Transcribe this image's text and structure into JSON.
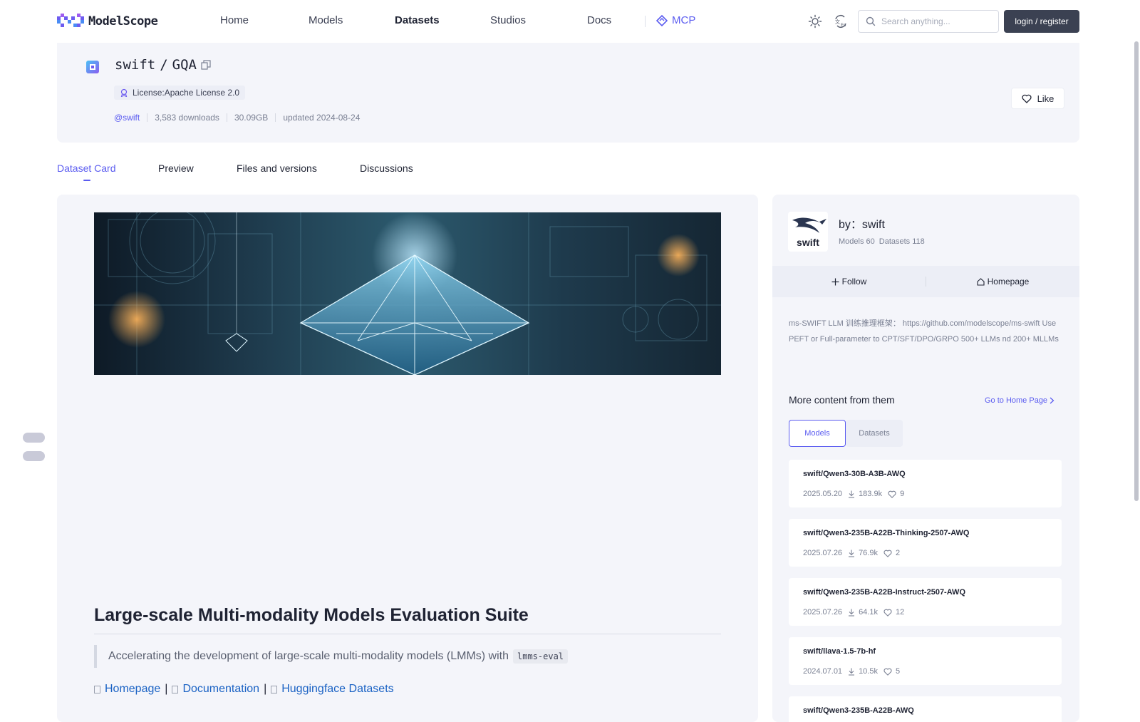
{
  "brand": {
    "logo_text": "ModelScope",
    "accent": "#5b5cf0"
  },
  "nav": {
    "items": [
      "Home",
      "Models",
      "Datasets",
      "Studios",
      "Docs"
    ],
    "mcp_label": "MCP"
  },
  "search": {
    "placeholder": "Search anything..."
  },
  "login_label": "login / register",
  "dataset": {
    "owner": "swift",
    "separator": "/",
    "name": "GQA",
    "license": "License:Apache License 2.0",
    "owner_handle": "@swift",
    "downloads": "3,583 downloads",
    "size": "30.09GB",
    "updated": "updated 2024-08-24",
    "like_label": "Like"
  },
  "tabs": [
    "Dataset Card",
    "Preview",
    "Files and versions",
    "Discussions"
  ],
  "card": {
    "title": "Large-scale Multi-modality Models Evaluation Suite",
    "quote_text": "Accelerating the development of large-scale multi-modality models (LMMs) with",
    "quote_code": "lmms-eval",
    "links": [
      "Homepage",
      "Documentation",
      "Huggingface Datasets"
    ],
    "link_sep": "|"
  },
  "author": {
    "by_label": "by：",
    "name": "swift",
    "avatar_text": "swift",
    "models_stat": "Models 60",
    "datasets_stat": "Datasets 118",
    "follow_label": "Follow",
    "homepage_label": "Homepage",
    "description": "ms-SWIFT LLM 训练推理框架： https://github.com/modelscope/ms-swift Use PEFT or Full-parameter to CPT/SFT/DPO/GRPO 500+ LLMs nd 200+ MLLMs"
  },
  "more": {
    "title": "More content from them",
    "goto_label": "Go to Home Page",
    "seg": [
      "Models",
      "Datasets"
    ],
    "items": [
      {
        "name": "swift/Qwen3-30B-A3B-AWQ",
        "date": "2025.05.20",
        "downloads": "183.9k",
        "likes": "9"
      },
      {
        "name": "swift/Qwen3-235B-A22B-Thinking-2507-AWQ",
        "date": "2025.07.26",
        "downloads": "76.9k",
        "likes": "2"
      },
      {
        "name": "swift/Qwen3-235B-A22B-Instruct-2507-AWQ",
        "date": "2025.07.26",
        "downloads": "64.1k",
        "likes": "12"
      },
      {
        "name": "swift/llava-1.5-7b-hf",
        "date": "2024.07.01",
        "downloads": "10.5k",
        "likes": "5"
      },
      {
        "name": "swift/Qwen3-235B-A22B-AWQ",
        "date": "",
        "downloads": "",
        "likes": ""
      }
    ]
  }
}
